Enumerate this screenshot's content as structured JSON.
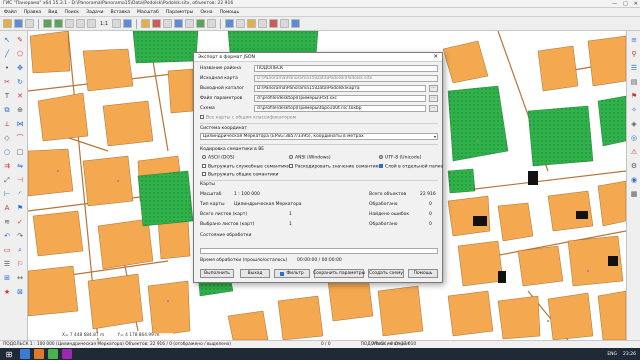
{
  "window": {
    "title": "ГИС \"Панорама\" x64 15.3.1 - D:\\Panorama\\Panorama15\\Data\\Podolsk\\Podolsk.sitx, объектов: 22 916",
    "min": "—",
    "max": "□",
    "close": "✕"
  },
  "menu": [
    "Файл",
    "Правка",
    "Вид",
    "Поиск",
    "Задачи",
    "Вставка",
    "Масштаб",
    "Параметры",
    "Окна",
    "Помощь"
  ],
  "toolbar": {
    "scale_ratio": "1:1"
  },
  "dialog": {
    "title": "Экспорт в формат JSON",
    "close": "✕",
    "region_label": "Название района",
    "region_value": "ПОДОЛЬСК",
    "source_map_label": "Исходная карта",
    "source_map_value": "D:\\Panorama\\Panorama15\\Data\\Podolsk\\Podolsk.sitx",
    "output_dir_label": "Выходной каталог",
    "output_dir_value": "D:\\Panorama\\Panorama15\\Data\\Podolsk\\карта",
    "params_file_label": "Файл параметров",
    "params_file_value": "d:\\profile\\desktop\\Примеры\\Ftxt.sxc",
    "scheme_label": "Схема",
    "scheme_value": "d:\\profile\\desktop\\Примеры\\topo100t.rsc.toxbp",
    "all_maps_check": "Все карты с общим классификатором",
    "crs_label": "Система координат",
    "crs_value": "Цилиндрическая Меркатора (EPSG:3857/3395), координаты в метрах",
    "encoding_label": "Кодировка семантики в ВЕ",
    "enc_ascii": "ASCII (DOS)",
    "enc_ansi": "ANSI (Windows)",
    "enc_utf8": "UTF-8 (Unicode)",
    "opt_service": "Выгружать служебные семантики",
    "opt_expand": "Раскодировать значение семантики",
    "opt_layer": "Слой в отдельной папке",
    "opt_common": "Выгружать общие семантики",
    "maps_group": "Карты",
    "scale_label": "Масштаб",
    "scale_value": "1 : 100 000",
    "projection_label": "Тип карты",
    "projection_value": "Цилиндрическая Меркатора",
    "sheets_total_label": "Всего листов (карт)",
    "sheets_total_value": "1",
    "sheets_sel_label": "Выбрано листов (карт)",
    "sheets_sel_value": "1",
    "objects_total_label": "Всего объектов",
    "objects_total_value": "22 916",
    "processed_label": "Обработано",
    "processed_value": "0",
    "errors_label": "Найдено ошибок",
    "errors_value": "0",
    "processed2_label": "Обработано",
    "processed2_value": "0",
    "state_label": "Состояние обработки",
    "time_label": "Время обработки (прошло/осталось)",
    "time_value": "00:00:00 / 00:00:00",
    "progress_fraction": 0.0,
    "buttons": {
      "run": "Выполнить",
      "exit": "Выход",
      "filter": "Фильтр",
      "save_params": "Сохранить параметры",
      "create_scheme": "Создать схему",
      "help": "Помощь"
    }
  },
  "coords": {
    "x": "X= 7 448 684.87 m",
    "y": "Y= 4 178 864.99 m"
  },
  "status": {
    "text": "ПОДОЛЬСК 1 : 100 000 (Цилиндрическая Меркатора) Объектов: 22 916 / 0 (отображено / выделено)",
    "extra": "0 / 0",
    "map_label": "ПОДОЛЬСК / 0 О/-37-010",
    "right_text": "Атлас не открыт"
  },
  "taskbar": {
    "lang": "ENG",
    "time": "23:26"
  },
  "colors": {
    "building": "#f4a84f",
    "forest": "#2fb24a",
    "road": "#b5763a",
    "water": "#7fb6e6"
  }
}
